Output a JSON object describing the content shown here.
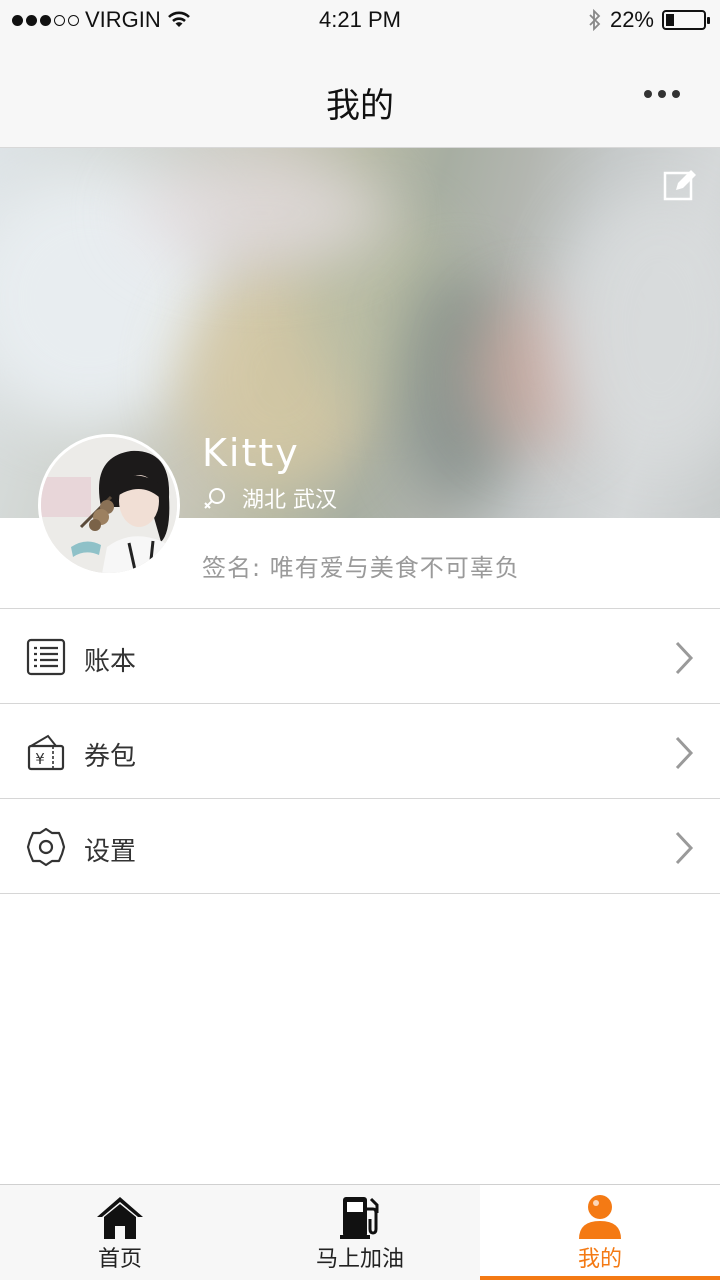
{
  "status_bar": {
    "carrier": "VIRGIN",
    "time": "4:21 PM",
    "battery": "22%",
    "battery_level": 0.22
  },
  "nav": {
    "title": "我的",
    "more_icon": "more-dots-icon"
  },
  "profile": {
    "name": "Kitty",
    "location": "湖北 武汉",
    "signature": "签名: 唯有爱与美食不可辜负",
    "gender_icon": "female-icon",
    "edit_icon": "edit-icon"
  },
  "menu": {
    "items": [
      {
        "label": "账本",
        "icon": "ledger-list-icon"
      },
      {
        "label": "券包",
        "icon": "coupon-wallet-icon"
      },
      {
        "label": "设置",
        "icon": "settings-gear-icon"
      }
    ]
  },
  "tabs": [
    {
      "label": "首页",
      "icon": "home-icon",
      "active": false
    },
    {
      "label": "马上加油",
      "icon": "fuel-pump-icon",
      "active": false
    },
    {
      "label": "我的",
      "icon": "user-icon",
      "active": true
    }
  ],
  "colors": {
    "accent": "#f47a14",
    "nav_bg": "#f7f7f7",
    "divider": "#d6d6d6"
  }
}
